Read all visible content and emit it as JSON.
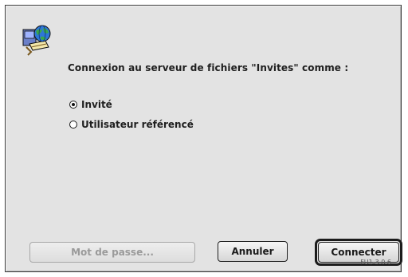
{
  "dialog": {
    "message": "Connexion au serveur de fichiers \"Invites\" comme :",
    "icon": "file-server-globe-icon",
    "options": [
      {
        "label": "Invité",
        "checked": true
      },
      {
        "label": "Utilisateur référencé",
        "checked": false
      }
    ],
    "buttons": {
      "password": "Mot de passe...",
      "cancel": "Annuler",
      "connect": "Connecter"
    },
    "version": "FU1-3.0.6"
  }
}
